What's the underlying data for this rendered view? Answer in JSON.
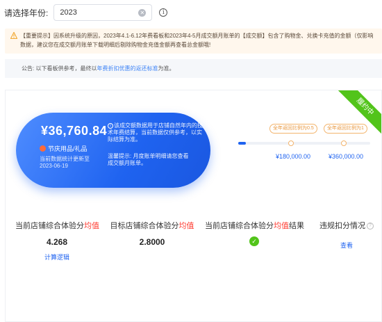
{
  "filter": {
    "label": "请选择年份:",
    "year_value": "2023",
    "clear_icon": "clear-circle-icon",
    "info_icon": "info-icon"
  },
  "warning": {
    "icon": "warning-triangle-icon",
    "text": "【重要提示】因系统升级的原因，2023年4.1-6.12年费看板和2023年4-5月成交额月账单的【成交额】包含了购物金、兑换卡充值的金额（仅影响数据，建议您在成交额月账单下载明细后剔除购物金充值金额再查看总金额哦!"
  },
  "notice": {
    "prefix": "公告: 以下看板供参考，最终以",
    "link": "年费折扣优惠的返还标准",
    "suffix": "为准。"
  },
  "card": {
    "ribbon": "履约中",
    "amount": "¥36,760.84",
    "category": "节庆用品/礼品",
    "updated": "当前数据统计更新至2023-06-19",
    "desc1": "该成交额数据用于店铺自然年内的技术年费结算，当前数据仅供参考，以实际结算为准。",
    "desc2": "温馨提示: 月度账单明细请您查看成交额月账单。",
    "progress": 0.06,
    "tiers": [
      {
        "label": "全年返回比例为0.5",
        "amount": "¥180,000.00"
      },
      {
        "label": "全年返回比例为1",
        "amount": "¥360,000.00"
      }
    ]
  },
  "metrics": [
    {
      "label_pre": "当前店铺综合体验分",
      "label_hl": "均值",
      "label_post": "",
      "value": "4.268",
      "link": "计算逻辑"
    },
    {
      "label_pre": "目标店铺综合体验分",
      "label_hl": "均值",
      "label_post": "",
      "value": "2.8000"
    },
    {
      "label_pre": "当前店铺综合体验分",
      "label_hl": "均值",
      "label_post": "结果",
      "icon": "check-circle-icon"
    },
    {
      "label_pre": "违规扣分情况",
      "label_hl": "",
      "label_post": "",
      "link": "查看",
      "help_icon": "question-circle-icon"
    }
  ],
  "colors": {
    "primary": "#1f63f0",
    "success": "#52c41a",
    "warning": "#e8953a",
    "highlight": "#ff3b30"
  }
}
